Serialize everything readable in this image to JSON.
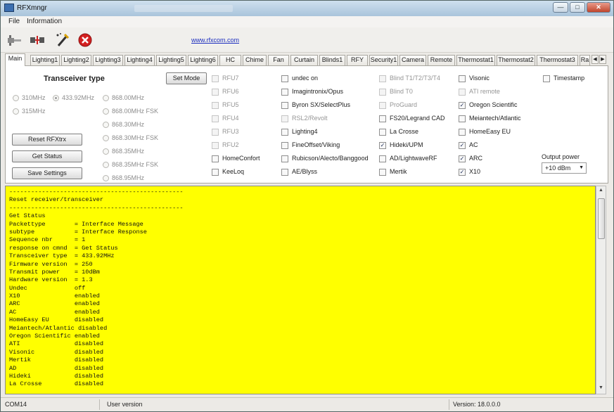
{
  "window": {
    "title": "RFXmngr",
    "background_title": "RFXCOM Flash Programmer"
  },
  "menu": [
    "File",
    "Information"
  ],
  "toolbar": {
    "link": "www.rfxcom.com",
    "icons": [
      "plug-icon",
      "disconnect-icon",
      "settings-wand-icon",
      "stop-icon"
    ]
  },
  "tabs": [
    "Main",
    "Lighting1",
    "Lighting2",
    "Lighting3",
    "Lighting4",
    "Lighting5",
    "Lighting6",
    "HC",
    "Chime",
    "Fan",
    "Curtain",
    "Blinds1",
    "RFY",
    "Security1",
    "Camera",
    "Remote",
    "Thermostat1",
    "Thermostat2",
    "Thermostat3",
    "Ra"
  ],
  "main": {
    "transceiver_heading": "Transceiver type",
    "set_mode": "Set Mode",
    "freq_left": [
      {
        "label": "310MHz",
        "selected": false
      },
      {
        "label": "315MHz",
        "selected": false
      }
    ],
    "freq_mid": {
      "label": "433.92MHz",
      "selected": true
    },
    "freq_right": [
      "868.00MHz",
      "868.00MHz FSK",
      "868.30MHz",
      "868.30MHz FSK",
      "868.35MHz",
      "868.35MHz FSK",
      "868.95MHz"
    ],
    "buttons": {
      "reset": "Reset RFXtrx",
      "status": "Get Status",
      "save": "Save Settings"
    },
    "col1": [
      {
        "label": "RFU7",
        "checked": false,
        "disabled": true
      },
      {
        "label": "RFU6",
        "checked": false,
        "disabled": true
      },
      {
        "label": "RFU5",
        "checked": false,
        "disabled": true
      },
      {
        "label": "RFU4",
        "checked": false,
        "disabled": true
      },
      {
        "label": "RFU3",
        "checked": false,
        "disabled": true
      },
      {
        "label": "RFU2",
        "checked": false,
        "disabled": true
      },
      {
        "label": "HomeConfort",
        "checked": false,
        "disabled": false
      },
      {
        "label": "KeeLoq",
        "checked": false,
        "disabled": false
      }
    ],
    "col2": [
      {
        "label": "undec on",
        "checked": false,
        "disabled": false
      },
      {
        "label": "Imagintronix/Opus",
        "checked": false,
        "disabled": false
      },
      {
        "label": "Byron SX/SelectPlus",
        "checked": false,
        "disabled": false
      },
      {
        "label": "RSL2/Revolt",
        "checked": false,
        "disabled": true
      },
      {
        "label": "Lighting4",
        "checked": false,
        "disabled": false
      },
      {
        "label": "FineOffset/Viking",
        "checked": false,
        "disabled": false
      },
      {
        "label": "Rubicson/Alecto/Banggood",
        "checked": false,
        "disabled": false
      },
      {
        "label": "AE/Blyss",
        "checked": false,
        "disabled": false
      }
    ],
    "col3": [
      {
        "label": "Blind T1/T2/T3/T4",
        "checked": false,
        "disabled": true
      },
      {
        "label": "Blind T0",
        "checked": false,
        "disabled": true
      },
      {
        "label": "ProGuard",
        "checked": false,
        "disabled": true
      },
      {
        "label": "FS20/Legrand CAD",
        "checked": false,
        "disabled": false
      },
      {
        "label": "La Crosse",
        "checked": false,
        "disabled": false
      },
      {
        "label": "Hideki/UPM",
        "checked": true,
        "disabled": false
      },
      {
        "label": "AD/LightwaveRF",
        "checked": false,
        "disabled": false
      },
      {
        "label": "Mertik",
        "checked": false,
        "disabled": false
      }
    ],
    "col4": [
      {
        "label": "Visonic",
        "checked": false,
        "disabled": false
      },
      {
        "label": "ATI remote",
        "checked": false,
        "disabled": true
      },
      {
        "label": "Oregon Scientific",
        "checked": true,
        "disabled": false
      },
      {
        "label": "Meiantech/Atlantic",
        "checked": false,
        "disabled": false
      },
      {
        "label": "HomeEasy EU",
        "checked": false,
        "disabled": false
      },
      {
        "label": "AC",
        "checked": true,
        "disabled": false
      },
      {
        "label": "ARC",
        "checked": true,
        "disabled": false
      },
      {
        "label": "X10",
        "checked": true,
        "disabled": false
      }
    ],
    "timestamp": {
      "label": "Timestamp",
      "checked": false
    },
    "output_power": {
      "label": "Output power",
      "value": "+10 dBm"
    }
  },
  "log": [
    "------------------------------------------------",
    "Reset receiver/transceiver",
    "------------------------------------------------",
    "Get Status",
    "Packettype        = Interface Message",
    "subtype           = Interface Response",
    "Sequence nbr      = 1",
    "response on cmnd  = Get Status",
    "Transceiver type  = 433.92MHz",
    "Firmware version  = 250",
    "Transmit power    = 10dBm",
    "Hardware version  = 1.3",
    "Undec             off",
    "X10               enabled",
    "ARC               enabled",
    "AC                enabled",
    "HomeEasy EU       disabled",
    "Meiantech/Atlantic disabled",
    "Oregon Scientific enabled",
    "ATI               disabled",
    "Visonic           disabled",
    "Mertik            disabled",
    "AD                disabled",
    "Hideki            disabled",
    "La Crosse         disabled"
  ],
  "status": {
    "port": "COM14",
    "user": "User version",
    "version": "Version: 18.0.0.0"
  },
  "colors": {
    "log_bg": "#ffff00",
    "link": "#1d2fbf"
  }
}
